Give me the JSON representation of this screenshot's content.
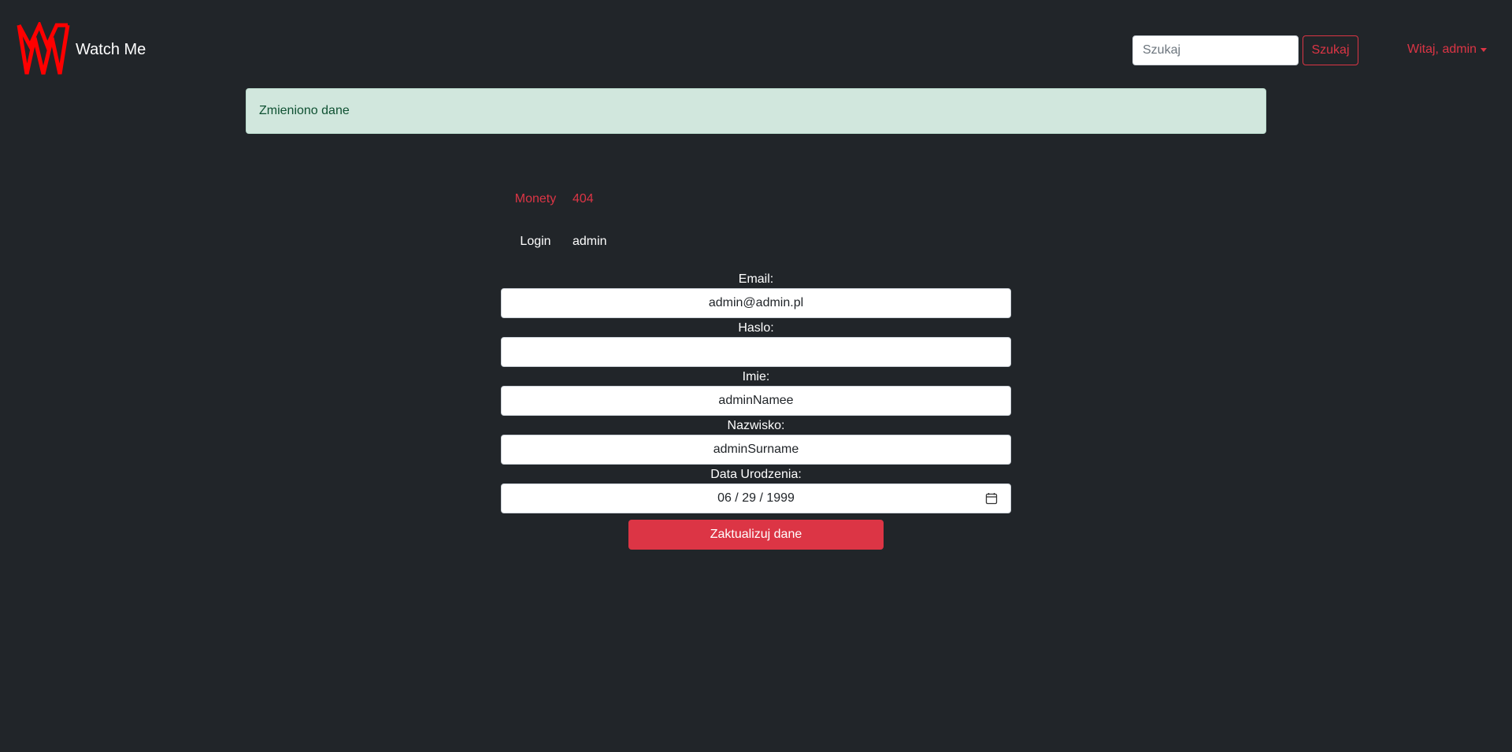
{
  "navbar": {
    "brand_name": "Watch Me",
    "search_placeholder": "Szukaj",
    "search_button_label": "Szukaj",
    "user_menu_label": "Witaj, admin"
  },
  "alert": {
    "message": "Zmieniono dane"
  },
  "info": {
    "coins_label": "Monety",
    "coins_value": "404",
    "login_label": "Login",
    "login_value": "admin"
  },
  "form": {
    "email_label": "Email:",
    "email_value": "admin@admin.pl",
    "password_label": "Haslo:",
    "password_value": "",
    "first_name_label": "Imie:",
    "first_name_value": "adminNamee",
    "last_name_label": "Nazwisko:",
    "last_name_value": "adminSurname",
    "birth_date_label": "Data Urodzenia:",
    "birth_date_value": "06 / 29 / 1999",
    "submit_label": "Zaktualizuj dane"
  },
  "colors": {
    "background": "#212529",
    "accent": "#dc3545",
    "alert_bg": "#d1e7dd",
    "alert_text": "#0f5132",
    "logo": "#ff0000"
  },
  "icons": {
    "logo": "watch-me-logo-icon",
    "dropdown": "caret-down-icon",
    "date_picker": "calendar-icon"
  }
}
